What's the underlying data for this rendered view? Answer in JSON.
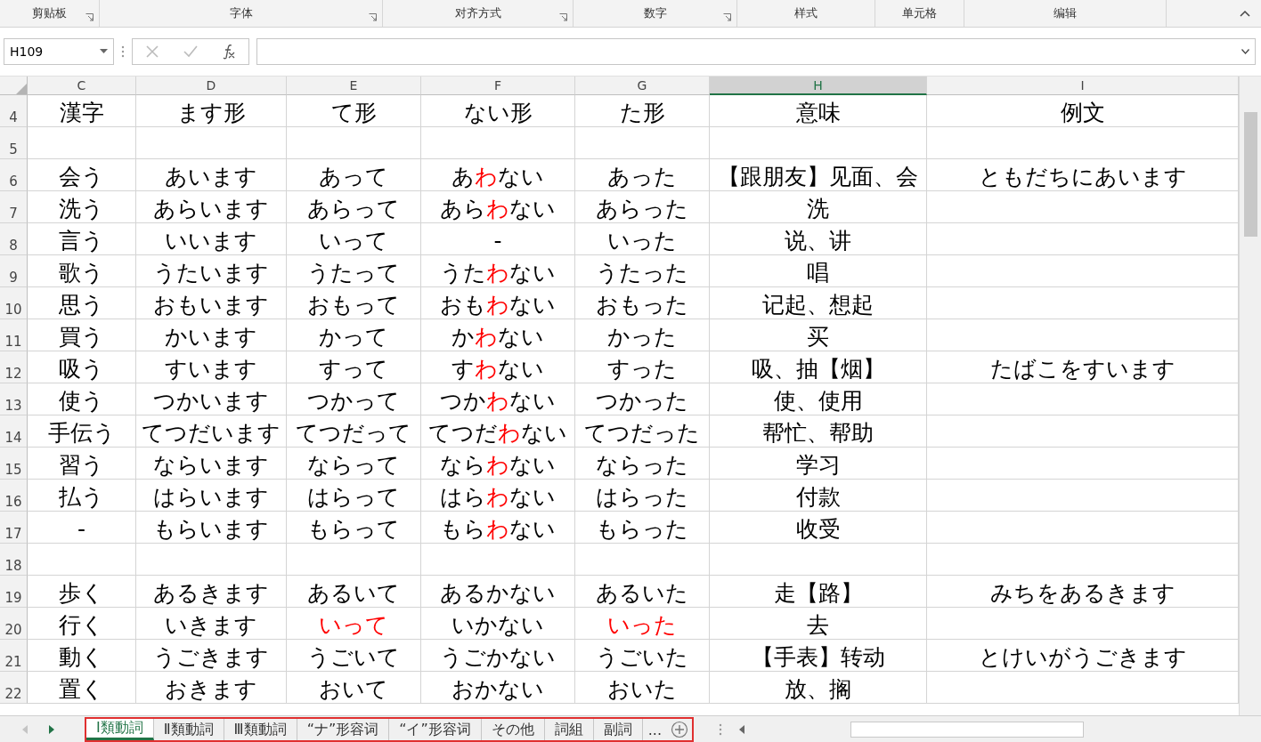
{
  "ribbon": {
    "groups": [
      {
        "label": "剪贴板",
        "launcher": true
      },
      {
        "label": "字体",
        "launcher": true
      },
      {
        "label": "对齐方式",
        "launcher": true
      },
      {
        "label": "数字",
        "launcher": true
      },
      {
        "label": "样式",
        "launcher": false
      },
      {
        "label": "单元格",
        "launcher": false
      },
      {
        "label": "编辑",
        "launcher": false
      }
    ]
  },
  "formula_bar": {
    "name_box": "H109"
  },
  "columns": [
    {
      "label": "C",
      "selected": false
    },
    {
      "label": "D",
      "selected": false
    },
    {
      "label": "E",
      "selected": false
    },
    {
      "label": "F",
      "selected": false
    },
    {
      "label": "G",
      "selected": false
    },
    {
      "label": "H",
      "selected": true
    },
    {
      "label": "I",
      "selected": false
    }
  ],
  "rows": [
    {
      "number": "4",
      "cells": [
        "漢字",
        "ます形",
        "て形",
        "ない形",
        "た形",
        "意味",
        "例文"
      ]
    },
    {
      "number": "5",
      "cells": [
        null,
        null,
        null,
        null,
        null,
        null,
        null
      ]
    },
    {
      "number": "6",
      "cells": [
        "会う",
        "あいます",
        "あって",
        {
          "segments": [
            {
              "text": "あ"
            },
            {
              "text": "わ",
              "color": "#ff0000"
            },
            {
              "text": "ない"
            }
          ]
        },
        "あった",
        "【跟朋友】见面、会",
        "ともだちにあいます"
      ]
    },
    {
      "number": "7",
      "cells": [
        "洗う",
        "あらいます",
        "あらって",
        {
          "segments": [
            {
              "text": "あら"
            },
            {
              "text": "わ",
              "color": "#ff0000"
            },
            {
              "text": "ない"
            }
          ]
        },
        "あらった",
        "洗",
        null
      ]
    },
    {
      "number": "8",
      "cells": [
        "言う",
        "いいます",
        "いって",
        "-",
        "いった",
        "说、讲",
        null
      ]
    },
    {
      "number": "9",
      "cells": [
        "歌う",
        "うたいます",
        "うたって",
        {
          "segments": [
            {
              "text": "うた"
            },
            {
              "text": "わ",
              "color": "#ff0000"
            },
            {
              "text": "ない"
            }
          ]
        },
        "うたった",
        "唱",
        null
      ]
    },
    {
      "number": "10",
      "cells": [
        "思う",
        "おもいます",
        "おもって",
        {
          "segments": [
            {
              "text": "おも"
            },
            {
              "text": "わ",
              "color": "#ff0000"
            },
            {
              "text": "ない"
            }
          ]
        },
        "おもった",
        "记起、想起",
        null
      ]
    },
    {
      "number": "11",
      "cells": [
        "買う",
        "かいます",
        "かって",
        {
          "segments": [
            {
              "text": "か"
            },
            {
              "text": "わ",
              "color": "#ff0000"
            },
            {
              "text": "ない"
            }
          ]
        },
        "かった",
        "买",
        null
      ]
    },
    {
      "number": "12",
      "cells": [
        "吸う",
        "すいます",
        "すって",
        {
          "segments": [
            {
              "text": "す"
            },
            {
              "text": "わ",
              "color": "#ff0000"
            },
            {
              "text": "ない"
            }
          ]
        },
        "すった",
        "吸、抽【烟】",
        "たばこをすいます"
      ]
    },
    {
      "number": "13",
      "cells": [
        "使う",
        "つかいます",
        "つかって",
        {
          "segments": [
            {
              "text": "つか"
            },
            {
              "text": "わ",
              "color": "#ff0000"
            },
            {
              "text": "ない"
            }
          ]
        },
        "つかった",
        "使、使用",
        null
      ]
    },
    {
      "number": "14",
      "cells": [
        "手伝う",
        "てつだいます",
        "てつだって",
        {
          "segments": [
            {
              "text": "てつだ"
            },
            {
              "text": "わ",
              "color": "#ff0000"
            },
            {
              "text": "ない"
            }
          ]
        },
        "てつだった",
        "帮忙、帮助",
        null
      ]
    },
    {
      "number": "15",
      "cells": [
        "習う",
        "ならいます",
        "ならって",
        {
          "segments": [
            {
              "text": "なら"
            },
            {
              "text": "わ",
              "color": "#ff0000"
            },
            {
              "text": "ない"
            }
          ]
        },
        "ならった",
        "学习",
        null
      ]
    },
    {
      "number": "16",
      "cells": [
        "払う",
        "はらいます",
        "はらって",
        {
          "segments": [
            {
              "text": "はら"
            },
            {
              "text": "わ",
              "color": "#ff0000"
            },
            {
              "text": "ない"
            }
          ]
        },
        "はらった",
        "付款",
        null
      ]
    },
    {
      "number": "17",
      "cells": [
        "-",
        "もらいます",
        "もらって",
        {
          "segments": [
            {
              "text": "もら"
            },
            {
              "text": "わ",
              "color": "#ff0000"
            },
            {
              "text": "ない"
            }
          ]
        },
        "もらった",
        "收受",
        null
      ]
    },
    {
      "number": "18",
      "cells": [
        null,
        null,
        null,
        null,
        null,
        null,
        null
      ]
    },
    {
      "number": "19",
      "cells": [
        "歩く",
        "あるきます",
        "あるいて",
        "あるかない",
        "あるいた",
        "走【路】",
        "みちをあるきます"
      ]
    },
    {
      "number": "20",
      "cells": [
        "行く",
        "いきます",
        {
          "text": "いって",
          "color": "#ff0000"
        },
        "いかない",
        {
          "text": "いった",
          "color": "#ff0000"
        },
        "去",
        null
      ]
    },
    {
      "number": "21",
      "cells": [
        "動く",
        "うごきます",
        "うごいて",
        "うごかない",
        "うごいた",
        "【手表】转动",
        "とけいがうごきます"
      ]
    },
    {
      "number": "22",
      "cells": [
        "置く",
        "おきます",
        "おいて",
        "おかない",
        "おいた",
        "放、搁",
        null
      ]
    }
  ],
  "sheet_tabs": [
    {
      "label": "Ⅰ類動詞",
      "selected": true
    },
    {
      "label": "Ⅱ類動詞",
      "selected": false
    },
    {
      "label": "Ⅲ類動詞",
      "selected": false
    },
    {
      "label": "“ナ”形容词",
      "selected": false
    },
    {
      "label": "“イ”形容词",
      "selected": false
    },
    {
      "label": "その他",
      "selected": false
    },
    {
      "label": "詞組",
      "selected": false
    },
    {
      "label": "副詞",
      "selected": false
    }
  ],
  "more_tabs": "..."
}
